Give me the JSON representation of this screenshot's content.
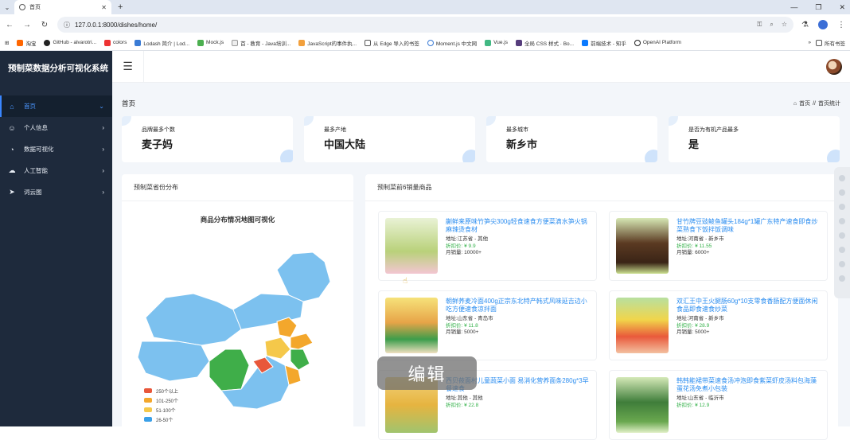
{
  "browser": {
    "tab_title": "首页",
    "url": "127.0.0.1:8000/dishes/home/",
    "bookmarks": [
      "淘宝",
      "GitHub - alvarotri...",
      "colors",
      "Lodash 简介 | Lod...",
      "Mock.js",
      "首 - 教育 - Java培训...",
      "JavaScript的事件执...",
      "从 Edge 导入的书签",
      "Moment.js 中文网",
      "Vue.js",
      "全局 CSS 样式 · Bo...",
      "前端技术 - 知乎",
      "OpenAI Platform"
    ],
    "all_bookmarks": "所有书签"
  },
  "sidebar": {
    "brand": "预制菜数据分析可视化系统",
    "items": [
      {
        "label": "首页",
        "icon": "home-icon"
      },
      {
        "label": "个人信息",
        "icon": "user-icon"
      },
      {
        "label": "数据可视化",
        "icon": "chart-icon"
      },
      {
        "label": "人工智能",
        "icon": "cloud-icon"
      },
      {
        "label": "词云图",
        "icon": "send-icon"
      }
    ]
  },
  "page": {
    "title": "首页",
    "breadcrumb": {
      "home": "首页",
      "sep": "//",
      "current": "首页统计"
    }
  },
  "stats": [
    {
      "label": "品牌最多个数",
      "value": "麦子妈"
    },
    {
      "label": "最多产地",
      "value": "中国大陆"
    },
    {
      "label": "最多城市",
      "value": "新乡市"
    },
    {
      "label": "是否为有机产品最多",
      "value": "是"
    }
  ],
  "map_panel": {
    "title": "预制菜省份分布",
    "chart_title": "商品分布情况地图可视化",
    "legend": [
      {
        "label": "250个以上",
        "color": "#e8573a"
      },
      {
        "label": "101-250个",
        "color": "#f3a72c"
      },
      {
        "label": "51-100个",
        "color": "#f5c84a"
      },
      {
        "label": "26-50个",
        "color": "#3aa0e8"
      }
    ]
  },
  "products_panel": {
    "title": "预制菜前6销量商品",
    "items": [
      {
        "name": "蒯鲜来原味竹笋尖300g轻食速食方便菜滴水笋火锅麻辣烫食材",
        "addr": "地址:江苏省 - 其他",
        "price": "折扣价: ¥ 9.9",
        "sales": "月销量: 10000+"
      },
      {
        "name": "甘竹牌豆豉鲮鱼罐头184g*1罐广东特产速食即食炒菜熟食下饭拌饭调味",
        "addr": "地址:河南省 - 新乡市",
        "price": "折扣价: ¥ 11.55",
        "sales": "月销量: 6000+"
      },
      {
        "name": "朝鲜荞麦冷面400g正宗东北特产韩式风味延吉边小吃方便速食凉拌面",
        "addr": "地址:山东省 - 青岛市",
        "price": "折扣价: ¥ 11.8",
        "sales": "月销量: 5000+"
      },
      {
        "name": "双汇王中王火腿肠60g*10支零食香肠配方便面休闲食品即食速食炒菜",
        "addr": "地址:河南省 - 新乡市",
        "price": "折扣价: ¥ 28.9",
        "sales": "月销量: 5000+"
      },
      {
        "name": "西贝莜面村儿童蔬菜小面 易消化营养面条280g*3早餐速食",
        "addr": "地址:其他 - 其他",
        "price": "折扣价: ¥ 22.8",
        "sales": ""
      },
      {
        "name": "韩韩能裙带菜速食汤冲泡即食紫菜虾皮汤料包海藻蛋花汤免煮小包装",
        "addr": "地址:山东省 - 临沂市",
        "price": "折扣价: ¥ 12.9",
        "sales": ""
      }
    ]
  },
  "overlay_text": "编辑"
}
